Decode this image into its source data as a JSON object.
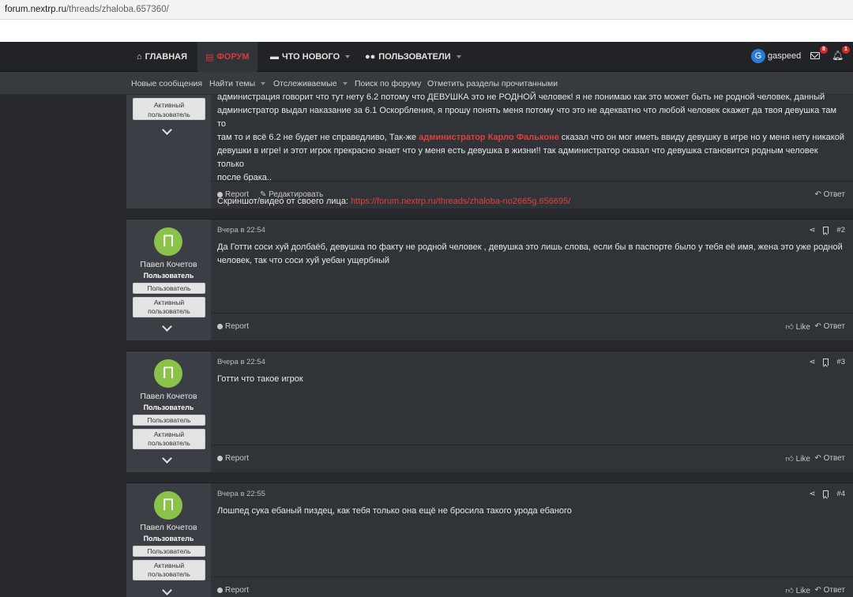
{
  "browser": {
    "url_host": "forum.nextrp.ru",
    "url_path": "/threads/zhaloba.657360/"
  },
  "nav": {
    "home": "ГЛАВНАЯ",
    "forum": "ФОРУМ",
    "whats_new": "ЧТО НОВОГО",
    "members": "ПОЛЬЗОВАТЕЛИ",
    "user_initial": "G",
    "username": "gaspeed",
    "messages_badge": "8",
    "alerts_badge": "1"
  },
  "subnav": {
    "new_posts": "Новые сообщения",
    "find_threads": "Найти темы",
    "watched": "Отслеживаемые",
    "search_forum": "Поиск по форуму",
    "mark_read": "Отметить разделы прочитанными"
  },
  "post1": {
    "active_btn": "Активный пользователь",
    "line1": "администрация говорит что тут нету 6.2 потому что ДЕВУШКА это не РОДНОЙ человек! я не понимаю как это может быть не родной человек, данный",
    "line2": "администратор выдал наказание за 6.1 Оскорбления, я прошу понять меня потому что это не адекватно что любой человек скажет да твоя девушка там то",
    "line3_a": "там то и всё 6.2 не будет не справедливо, Так-же ",
    "line3_red": "администратор Карло Фальконе",
    "line3_b": " сказал что он мог иметь ввиду девушку в игре но у меня нету никакой",
    "line4": "девушки в игре! и этот игрок прекрасно знает что у меня есть девушка в жизни!! так администратор сказал что девушка становится родным человек только",
    "line5": "после брака..",
    "evidence_label": "Скриншот/видео от своего лица: ",
    "evidence_link": "https://forum.nextrp.ru/threads/zhaloba-no2665g.656695/",
    "report": "Report",
    "edit": "Редактировать",
    "reply": "Ответ"
  },
  "posts": [
    {
      "avatar_letter": "П",
      "author": "Павел Кочетов",
      "role": "Пользователь",
      "btn1": "Пользователь",
      "btn2": "Активный пользователь",
      "date": "Вчера в 22:54",
      "number": "#2",
      "text": "Да Готти соси хуй долбаёб, девушка по факту не родной человек , девушка это лишь слова, если бы в паспорте было у тебя её имя, жена это уже родной человек, так что соси хуй уебан ущербный",
      "report": "Report",
      "like": "Like",
      "reply": "Ответ"
    },
    {
      "avatar_letter": "П",
      "author": "Павел Кочетов",
      "role": "Пользователь",
      "btn1": "Пользователь",
      "btn2": "Активный пользователь",
      "date": "Вчера в 22:54",
      "number": "#3",
      "text": "Готти что такое игрок",
      "report": "Report",
      "like": "Like",
      "reply": "Ответ"
    },
    {
      "avatar_letter": "П",
      "author": "Павел Кочетов",
      "role": "Пользователь",
      "btn1": "Пользователь",
      "btn2": "Активный пользователь",
      "date": "Вчера в 22:55",
      "number": "#4",
      "text": "Лошпед сука ебаный пиздец, как тебя только она ещё не бросила такого урода ебаного",
      "report": "Report",
      "like": "Like",
      "reply": "Ответ"
    }
  ],
  "colors": {
    "accent_red": "#d63a3a",
    "avatar_green": "#8bc34a",
    "nav_bg": "#212327",
    "post_bg": "#303338"
  }
}
